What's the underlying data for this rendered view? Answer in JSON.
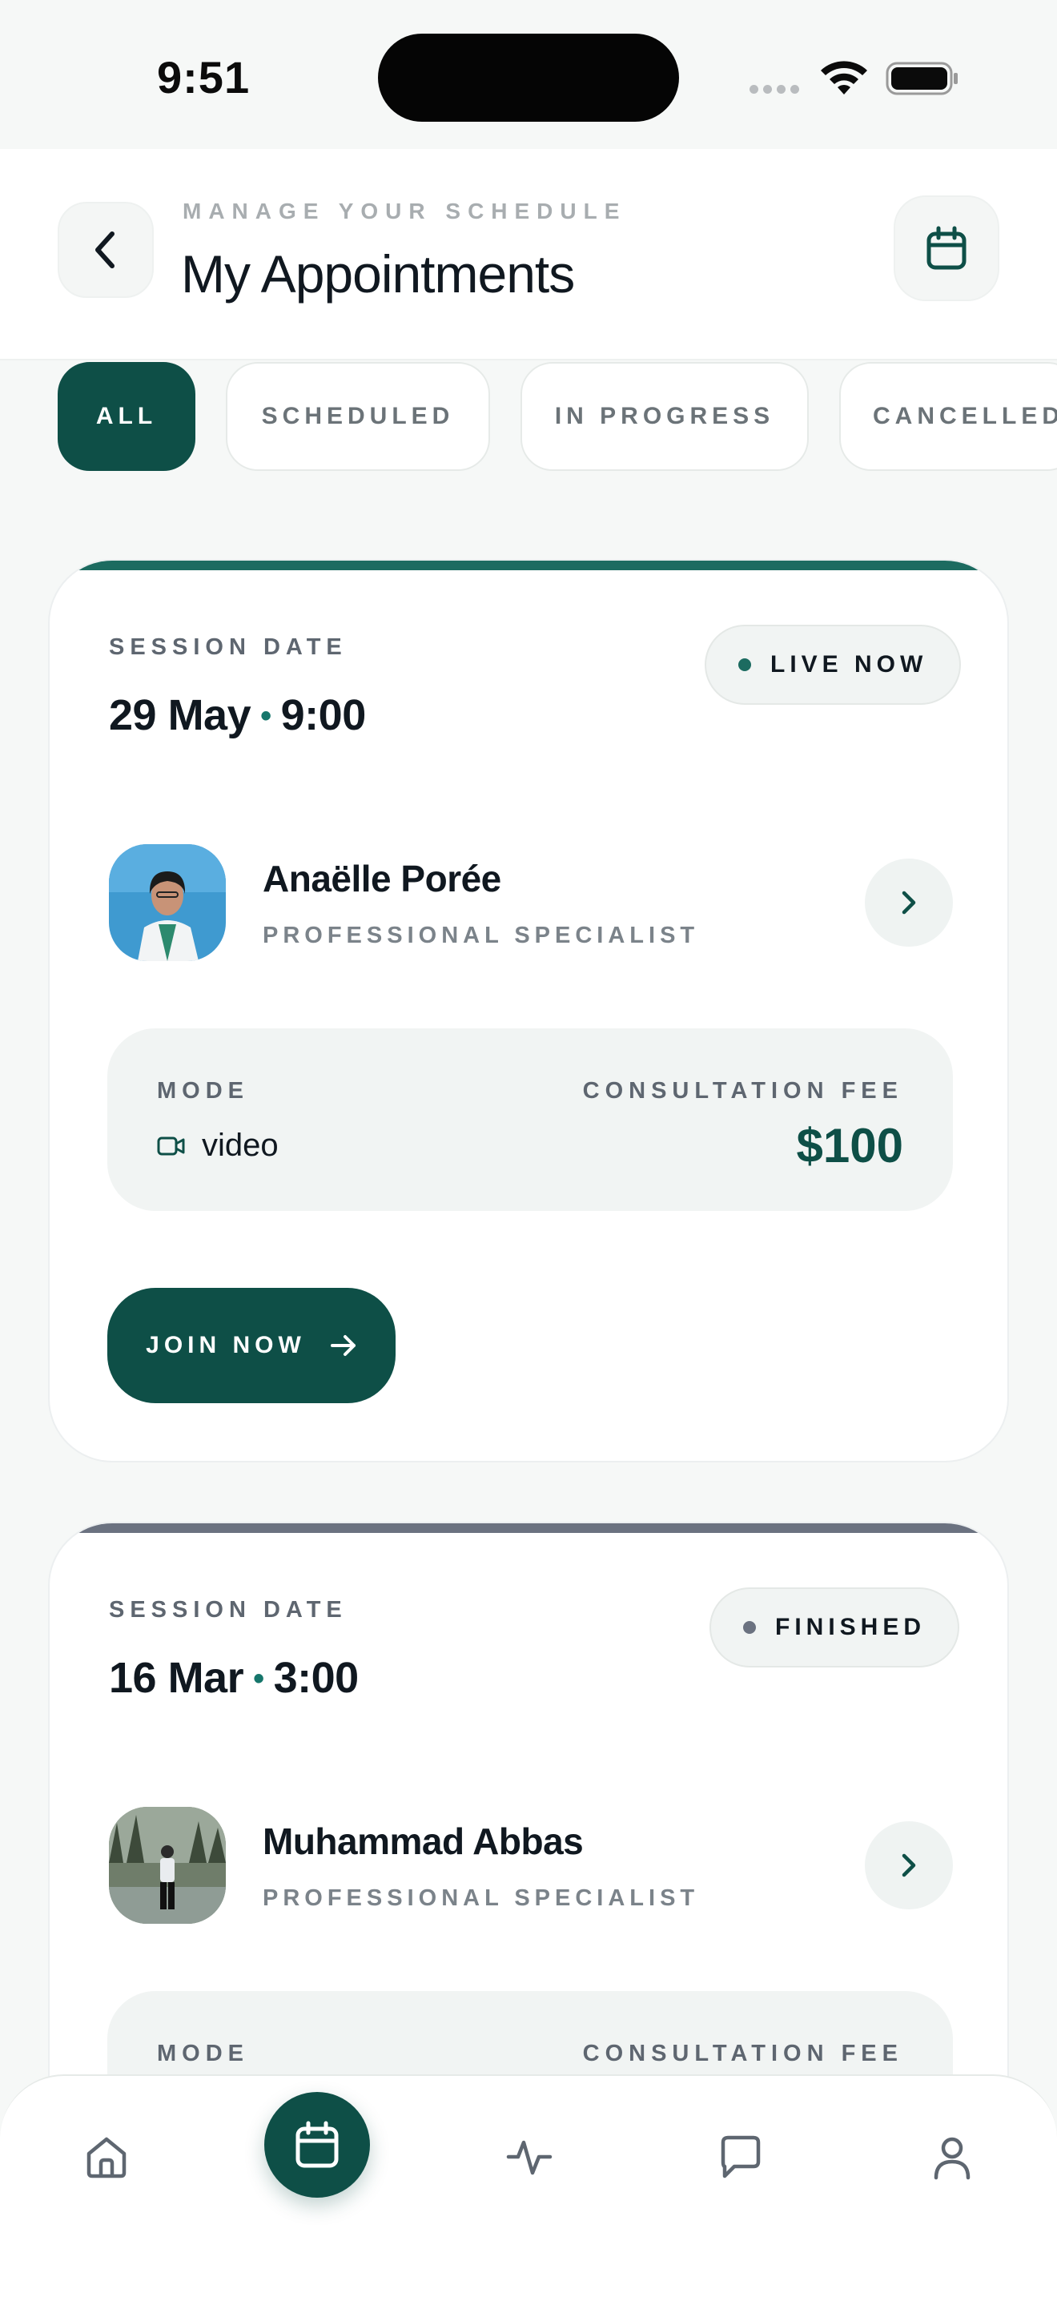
{
  "status_bar": {
    "time": "9:51"
  },
  "header": {
    "eyebrow": "MANAGE YOUR SCHEDULE",
    "title": "My Appointments",
    "back_icon": "chevron-left-icon",
    "calendar_icon": "calendar-icon"
  },
  "filters": [
    {
      "label": "ALL",
      "active": true
    },
    {
      "label": "SCHEDULED",
      "active": false
    },
    {
      "label": "IN PROGRESS",
      "active": false
    },
    {
      "label": "CANCELLED",
      "active": false
    }
  ],
  "appointments": [
    {
      "session_label": "SESSION DATE",
      "date": "29 May",
      "time": "9:00",
      "status": "LIVE NOW",
      "status_color": "#1c6b60",
      "accent_color": "#1c6b60",
      "doctor_name": "Anaëlle Porée",
      "doctor_role": "PROFESSIONAL SPECIALIST",
      "mode_label": "MODE",
      "mode_value": "video",
      "fee_label": "CONSULTATION FEE",
      "fee_value": "$100",
      "action_label": "JOIN NOW"
    },
    {
      "session_label": "SESSION DATE",
      "date": "16 Mar",
      "time": "3:00",
      "status": "FINISHED",
      "status_color": "#6b7280",
      "accent_color": "#6b7280",
      "doctor_name": "Muhammad Abbas",
      "doctor_role": "PROFESSIONAL SPECIALIST",
      "mode_label": "MODE",
      "fee_label": "CONSULTATION FEE"
    }
  ],
  "bottom_nav": [
    {
      "icon": "home-icon",
      "active": false
    },
    {
      "icon": "calendar-icon",
      "active": true
    },
    {
      "icon": "activity-icon",
      "active": false
    },
    {
      "icon": "chat-icon",
      "active": false
    },
    {
      "icon": "profile-icon",
      "active": false
    }
  ]
}
